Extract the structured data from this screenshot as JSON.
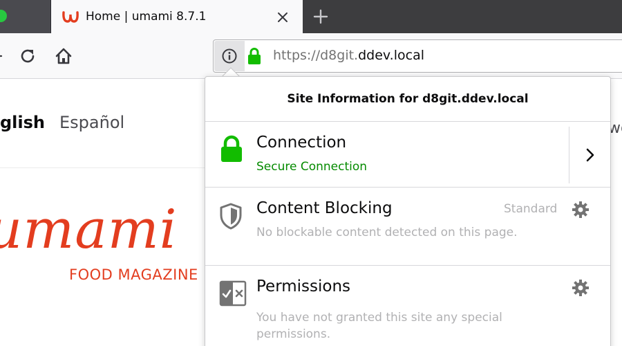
{
  "browser": {
    "tab": {
      "title": "Home | umami 8.7.1",
      "favicon": "umami-logo-icon"
    },
    "new_tab_icon": "plus-icon",
    "close_tab_icon": "close-icon",
    "url": {
      "scheme": "https://",
      "subdomain": "d8git.",
      "domain": "ddev.local"
    }
  },
  "page": {
    "languages": [
      "glish",
      "Español"
    ],
    "logo_word": "umami",
    "logo_tagline": "FOOD MAGAZINE",
    "offscreen_label": "wo"
  },
  "site_info_panel": {
    "title": "Site Information for d8git.ddev.local",
    "connection": {
      "title": "Connection",
      "status": "Secure Connection",
      "icon": "lock-icon"
    },
    "content_blocking": {
      "title": "Content Blocking",
      "level": "Standard",
      "description": "No blockable content detected on this page.",
      "icon": "shield-icon"
    },
    "permissions": {
      "title": "Permissions",
      "description": "You have not granted this site any special permissions.",
      "icon": "permissions-icon"
    }
  },
  "colors": {
    "secure_green": "#12bc00",
    "brand_red": "#e33d1f",
    "tab_strip": "#3d3d3f"
  }
}
